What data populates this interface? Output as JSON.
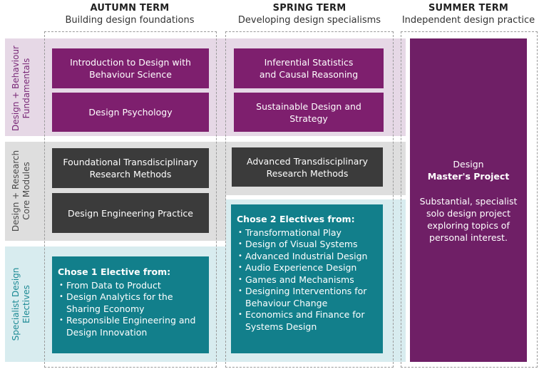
{
  "terms": {
    "autumn": {
      "title": "AUTUMN TERM",
      "subtitle": "Building design foundations"
    },
    "spring": {
      "title": "SPRING TERM",
      "subtitle": "Developing design specialisms"
    },
    "summer": {
      "title": "SUMMER TERM",
      "subtitle": "Independent design practice"
    }
  },
  "rows": {
    "design": {
      "line1": "Design + Behaviour",
      "line2": "Fundamentals"
    },
    "core": {
      "line1": "Design + Research",
      "line2": "Core Modules"
    },
    "specialist": {
      "line1": "Specialist Design",
      "line2": "Electives"
    }
  },
  "modules": {
    "autumn_design_1": {
      "line1": "Introduction to Design with",
      "line2": "Behaviour Science"
    },
    "autumn_design_2": {
      "line1": "Design Psychology"
    },
    "spring_design_1": {
      "line1": "Inferential Statistics",
      "line2": "and Causal Reasoning"
    },
    "spring_design_2": {
      "line1": "Sustainable Design and",
      "line2": "Strategy"
    },
    "autumn_core_1": {
      "line1": "Foundational Transdisciplinary",
      "line2": "Research Methods"
    },
    "autumn_core_2": {
      "line1": "Design Engineering Practice"
    },
    "spring_core_1": {
      "line1": "Advanced Transdisciplinary",
      "line2": "Research Methods"
    }
  },
  "electives": {
    "autumn": {
      "title": "Chose 1 Elective from:",
      "items": [
        "From Data to Product",
        "Design Analytics for the Sharing Economy",
        "Responsible Engineering and Design Innovation"
      ]
    },
    "spring": {
      "title": "Chose 2 Electives from:",
      "items": [
        "Transformational Play",
        "Design of Visual Systems",
        "Advanced Industrial Design",
        "Audio Experience Design",
        "Games and Mechanisms",
        "Designing Interventions for Behaviour Change",
        "Economics and Finance for Systems Design"
      ]
    }
  },
  "summer_project": {
    "title_line1": "Design",
    "title_line2": "Master's Project",
    "desc_line1": "Substantial, specialist",
    "desc_line2": "solo design project",
    "desc_line3": "exploring topics of",
    "desc_line4": "personal interest."
  },
  "colors": {
    "purple": "#7e1f6e",
    "gray": "#3b3b3b",
    "teal": "#127f8b",
    "summer": "#6f1f66",
    "band_design": "#e6d8e6",
    "band_core": "#dedede",
    "band_specialist": "#d8ecef"
  }
}
